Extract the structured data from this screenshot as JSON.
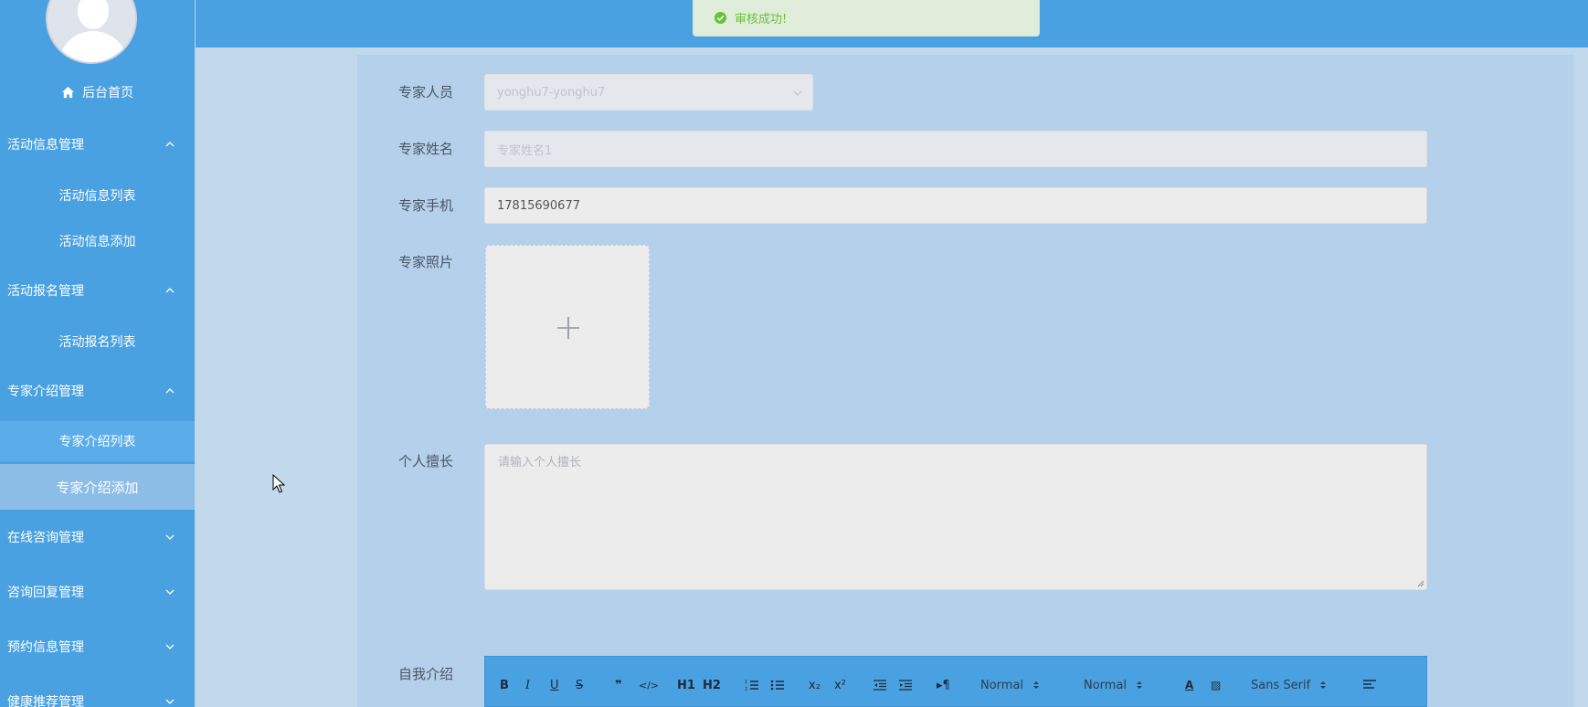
{
  "sidebar": {
    "home_label": "后台首页",
    "groups": [
      {
        "label": "活动信息管理",
        "expanded": true,
        "items": [
          "活动信息列表",
          "活动信息添加"
        ]
      },
      {
        "label": "活动报名管理",
        "expanded": true,
        "items": [
          "活动报名列表"
        ]
      },
      {
        "label": "专家介绍管理",
        "expanded": true,
        "items": [
          "专家介绍列表",
          "专家介绍添加"
        ]
      },
      {
        "label": "在线咨询管理",
        "expanded": false,
        "items": []
      },
      {
        "label": "咨询回复管理",
        "expanded": false,
        "items": []
      },
      {
        "label": "预约信息管理",
        "expanded": false,
        "items": []
      },
      {
        "label": "健康推荐管理",
        "expanded": false,
        "items": []
      }
    ],
    "active_item": "专家介绍添加"
  },
  "toast": {
    "message": "审核成功!",
    "type": "success",
    "color": "#67c23a"
  },
  "form": {
    "expert_user": {
      "label": "专家人员",
      "value": "yonghu7-yonghu7"
    },
    "expert_name": {
      "label": "专家姓名",
      "placeholder": "专家姓名1"
    },
    "expert_phone": {
      "label": "专家手机",
      "value": "17815690677"
    },
    "expert_photo": {
      "label": "专家照片"
    },
    "specialty": {
      "label": "个人擅长",
      "placeholder": "请输入个人擅长"
    },
    "self_intro": {
      "label": "自我介绍"
    }
  },
  "editor_toolbar": {
    "size_select": "Normal",
    "header_select": "Normal",
    "font_select": "Sans Serif",
    "h1": "H1",
    "h2": "H2",
    "sub": "x₂",
    "sup": "x²"
  },
  "colors": {
    "primary": "#4aa1e1",
    "active_item": "#8cbde6",
    "content_bg": "#c2d9ec"
  }
}
